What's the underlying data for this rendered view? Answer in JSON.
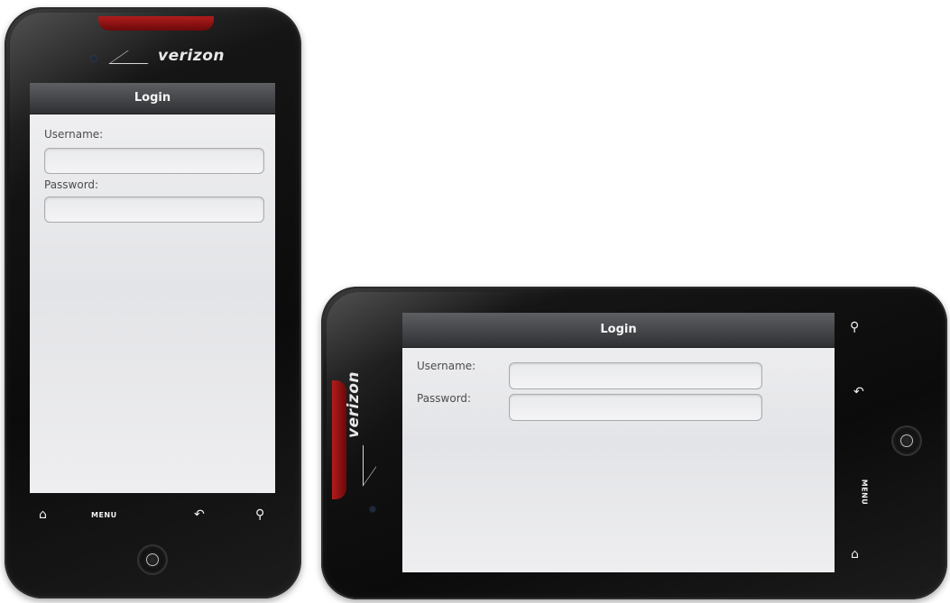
{
  "brand": "verizon",
  "screen": {
    "title": "Login",
    "username_label": "Username:",
    "password_label": "Password:",
    "username_value": "",
    "password_value": ""
  },
  "softkeys": {
    "home": "⌂",
    "menu": "MENU",
    "back": "↶",
    "search": "⚲"
  },
  "colors": {
    "titlebar": "#3a3c3f",
    "speaker_accent": "#b11c1c",
    "screen_bg": "#e8e9eb",
    "body": "#111111"
  }
}
